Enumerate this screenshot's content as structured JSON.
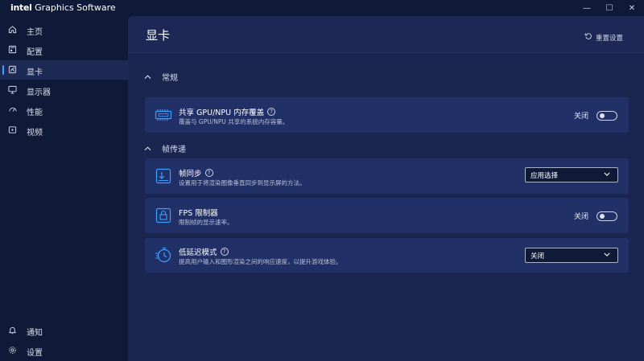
{
  "app": {
    "brand_intel": "intel",
    "brand_name": "Graphics Software"
  },
  "window_controls": {
    "minimize": "—",
    "maximize": "☐",
    "close": "✕"
  },
  "sidebar": {
    "items": [
      {
        "label": "主页",
        "icon": "home-icon"
      },
      {
        "label": "配置",
        "icon": "profile-icon"
      },
      {
        "label": "显卡",
        "icon": "graphics-icon",
        "active": true
      },
      {
        "label": "显示器",
        "icon": "monitor-icon"
      },
      {
        "label": "性能",
        "icon": "gauge-icon"
      },
      {
        "label": "视频",
        "icon": "video-icon"
      }
    ],
    "bottom_items": [
      {
        "label": "通知",
        "icon": "bell-icon"
      },
      {
        "label": "设置",
        "icon": "gear-icon"
      }
    ]
  },
  "header": {
    "title": "显卡",
    "reset_label": "重置设置"
  },
  "sections": {
    "general": {
      "title": "常规"
    },
    "frame": {
      "title": "帧传递"
    }
  },
  "cards": {
    "shared_memory": {
      "title": "共享 GPU/NPU 内存覆盖",
      "desc": "覆盖与 GPU/NPU 共享的系统内存容量。",
      "toggle_label": "关闭",
      "enabled": false
    },
    "frame_sync": {
      "title": "帧同步",
      "desc": "设置用于将渲染图像垂直同步到显示屏的方法。",
      "select_value": "应用选择"
    },
    "fps_limiter": {
      "title": "FPS 限制器",
      "desc": "限制帧的显示速率。",
      "toggle_label": "关闭",
      "enabled": false
    },
    "low_latency": {
      "title": "低延迟模式",
      "desc": "提高用户输入和图形渲染之间的响应速度，以提升游戏体验。",
      "select_value": "关闭"
    }
  },
  "colors": {
    "accent": "#3aa0ff",
    "background": "#0f1a38",
    "panel": "#1a2550",
    "card": "#223068"
  }
}
